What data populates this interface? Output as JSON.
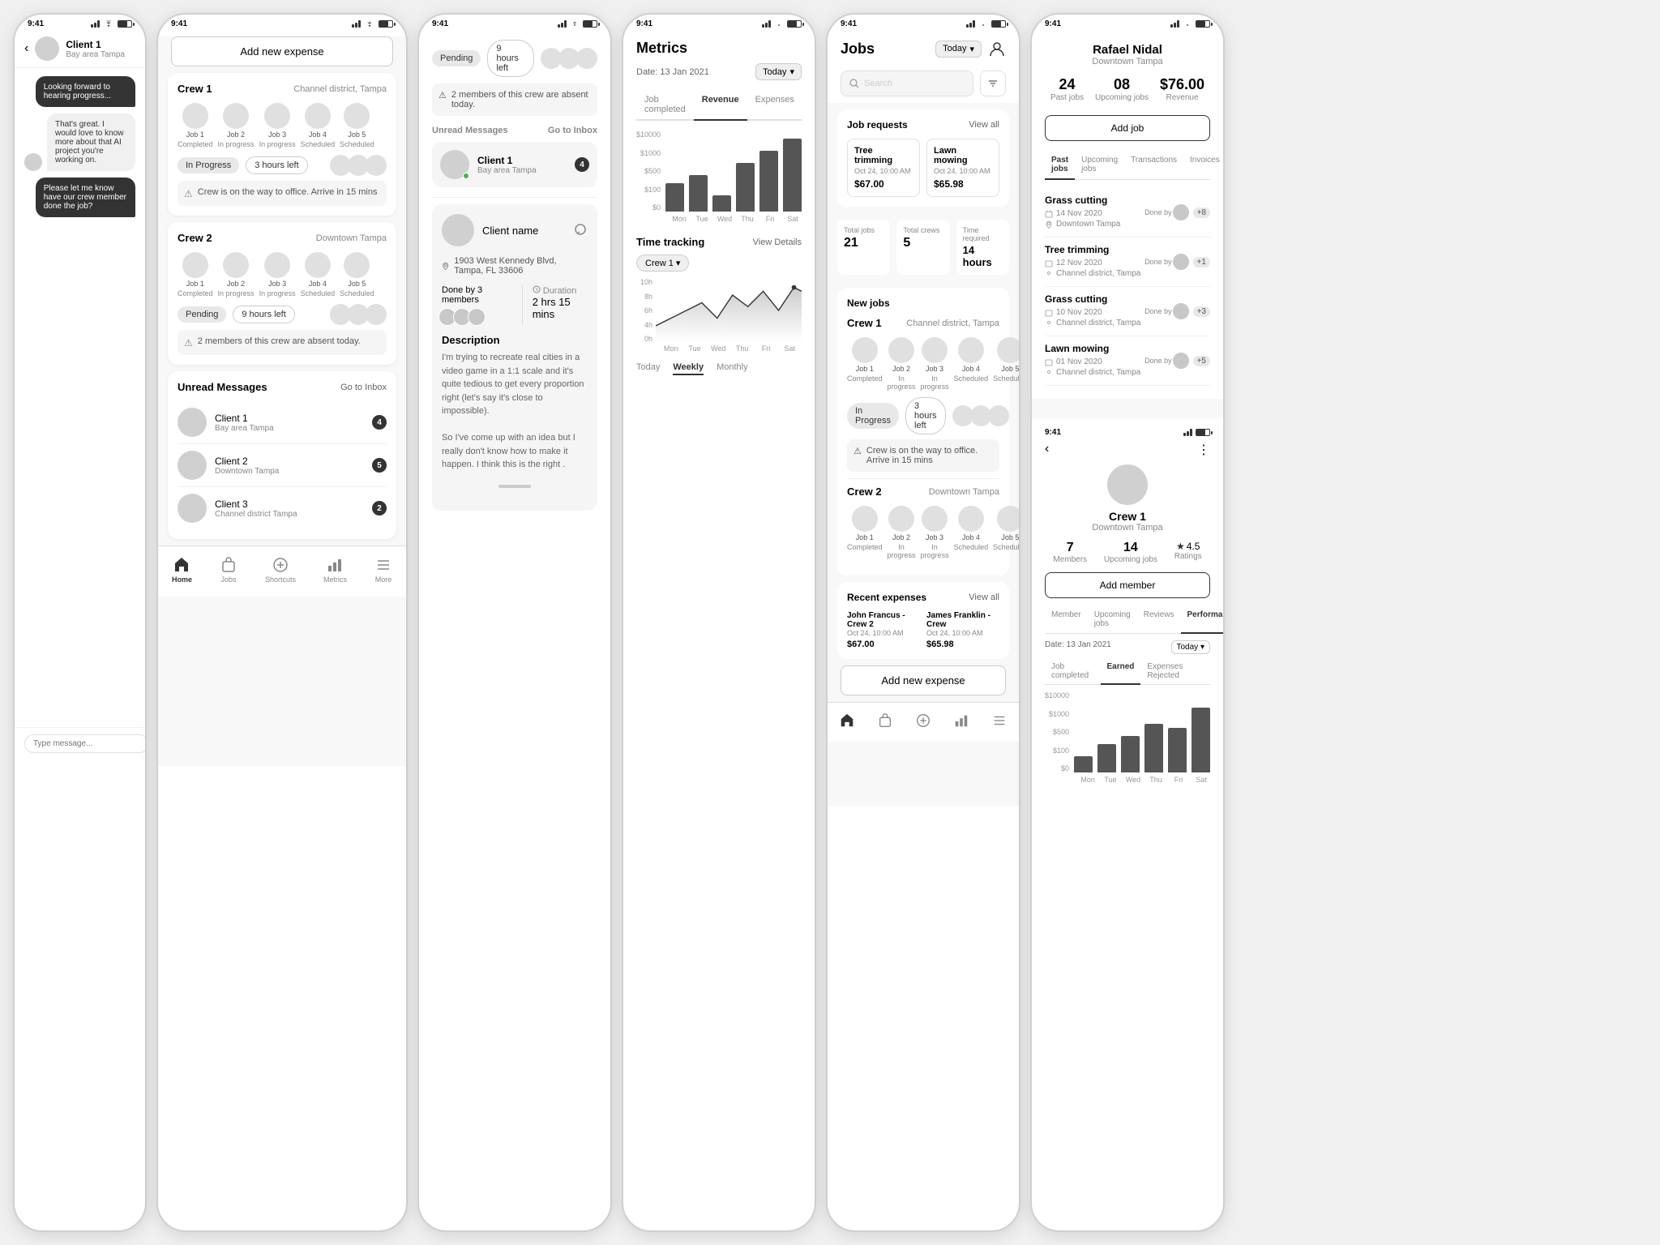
{
  "panels": {
    "panel1": {
      "title": "Home",
      "addExpenseBtn": "Add new expense",
      "crew1": {
        "name": "Crew 1",
        "location": "Channel district, Tampa",
        "status": "In Progress",
        "timeLeft": "3 hours left",
        "alert": "Crew is on the way to office. Arrive in 15 mins",
        "jobs": [
          {
            "label": "Job 1",
            "status": "Completed"
          },
          {
            "label": "Job 2",
            "status": "In progress"
          },
          {
            "label": "Job 3",
            "status": "In progress"
          },
          {
            "label": "Job 4",
            "status": "Scheduled"
          },
          {
            "label": "Job 5",
            "status": "Scheduled"
          }
        ]
      },
      "crew2": {
        "name": "Crew 2",
        "location": "Downtown Tampa",
        "status": "Pending",
        "timeLeft": "9 hours left",
        "alert": "2 members of this crew are absent today.",
        "jobs": [
          {
            "label": "Job 1",
            "status": "Completed"
          },
          {
            "label": "Job 2",
            "status": "In progress"
          },
          {
            "label": "Job 3",
            "status": "In progress"
          },
          {
            "label": "Job 4",
            "status": "Scheduled"
          },
          {
            "label": "Job 5",
            "status": "Scheduled"
          }
        ]
      },
      "messages": {
        "title": "Unread Messages",
        "link": "Go to Inbox",
        "clients": [
          {
            "name": "Client 1",
            "location": "Bay area Tampa",
            "count": 4
          },
          {
            "name": "Client 2",
            "location": "Downtown Tampa",
            "count": 5
          },
          {
            "name": "Client 3",
            "location": "Channel district Tampa",
            "count": 2
          }
        ]
      },
      "nav": {
        "items": [
          {
            "label": "Home",
            "icon": "home",
            "active": true
          },
          {
            "label": "Jobs",
            "icon": "jobs",
            "active": false
          },
          {
            "label": "Shortcuts",
            "icon": "shortcuts",
            "active": false
          },
          {
            "label": "Metrics",
            "icon": "metrics",
            "active": false
          },
          {
            "label": "More",
            "icon": "more",
            "active": false
          }
        ]
      }
    },
    "panel2": {
      "statusTime": "9:41",
      "pending": "Pending",
      "hoursLeft": "9 hours left",
      "alert": "2 members of this crew are absent today.",
      "clientName": "Client name",
      "location": "1903 West Kennedy Blvd, Tampa, FL 33606",
      "doneBy": "Done by 3 members",
      "duration": "Duration",
      "durationValue": "2 hrs 15 mins",
      "descriptionTitle": "Description",
      "descriptionText": "I'm trying to recreate real cities in a video game in a 1:1 scale and it's quite tedious to get every proportion right (let's say it's close to impossible).\n\nSo I've come up with an idea but I really don't know how to make it happen. I think this is the right ."
    },
    "panel3": {
      "statusTime": "9:41",
      "title": "Metrics",
      "dateLabel": "Date: 13 Jan 2021",
      "todayBtn": "Today",
      "tabs": [
        "Job completed",
        "Revenue",
        "Expenses"
      ],
      "activeTab": "Revenue",
      "chart": {
        "yLabels": [
          "$10000",
          "$1000",
          "$500",
          "$100",
          "$0"
        ],
        "xLabels": [
          "Mon",
          "Tue",
          "Wed",
          "Thu",
          "Fri",
          "Sat"
        ],
        "bars": [
          35,
          45,
          20,
          60,
          75,
          90
        ]
      },
      "timeTracking": {
        "title": "Time tracking",
        "link": "View Details",
        "crewLabel": "Crew 1",
        "yLabels": [
          "10h",
          "8h",
          "6h",
          "4h",
          "0h"
        ],
        "xLabels": [
          "Mon",
          "Tue",
          "Wed",
          "Thu",
          "Fri",
          "Sat"
        ]
      },
      "tabs2": [
        "Today",
        "Weekly",
        "Monthly"
      ],
      "activeTab2": "Weekly"
    },
    "panel4": {
      "statusTime": "9:41",
      "title": "Jobs",
      "todayBtn": "Today",
      "searchPlaceholder": "Search",
      "jobRequests": {
        "title": "Job requests",
        "link": "View all",
        "jobs": [
          {
            "title": "Tree trimming",
            "date": "Oct 24, 10:00 AM",
            "price": "$67.00"
          },
          {
            "title": "Lawn mowing",
            "date": "Oct 24, 10:00 AM",
            "price": "$65.98"
          }
        ]
      },
      "stats": [
        {
          "label": "Total jobs",
          "value": "21"
        },
        {
          "label": "Total crews",
          "value": "5"
        },
        {
          "label": "Time required",
          "value": "14 hours"
        }
      ],
      "newJobs": {
        "title": "New jobs",
        "crew1": {
          "name": "Crew 1",
          "location": "Channel district, Tampa",
          "jobs": [
            {
              "label": "Job 1",
              "status": "Completed"
            },
            {
              "label": "Job 2",
              "status": "In progress"
            },
            {
              "label": "Job 3",
              "status": "In progress"
            },
            {
              "label": "Job 4",
              "status": "Scheduled"
            },
            {
              "label": "Job 5",
              "status": "Scheduled"
            }
          ],
          "status": "In Progress",
          "timeLeft": "3 hours left",
          "alert": "Crew is on the way to office. Arrive in 15 mins"
        },
        "crew2": {
          "name": "Crew 2",
          "location": "Downtown Tampa",
          "jobs": [
            {
              "label": "Job 1",
              "status": "Completed"
            },
            {
              "label": "Job 2",
              "status": "In progress"
            },
            {
              "label": "Job 3",
              "status": "In progress"
            },
            {
              "label": "Job 4",
              "status": "Scheduled"
            },
            {
              "label": "Job 5",
              "status": "Scheduled"
            }
          ]
        }
      },
      "expenses": {
        "title": "Recent expenses",
        "link": "View all",
        "items": [
          {
            "name": "John Francus - Crew 2",
            "date": "Oct 24, 10:00 AM",
            "price": "$67.00"
          },
          {
            "name": "James Franklin - Crew",
            "date": "Oct 24, 10:00 AM",
            "price": "$65.98"
          }
        ]
      },
      "addExpenseBtn": "Add new expense"
    },
    "panel5": {
      "statusTime": "9:41",
      "client": {
        "name": "Rafael Nidal",
        "location": "Downtown Tampa",
        "pastJobs": "24",
        "pastJobsLabel": "Past jobs",
        "upcomingJobs": "08",
        "upcomingJobsLabel": "Upcoming jobs",
        "revenue": "$76.00",
        "revenueLabel": "Revenue",
        "addJobBtn": "Add job",
        "tabs": [
          "Past jobs",
          "Upcoming jobs",
          "Transactions",
          "Invoices"
        ],
        "activeTab": "Past jobs",
        "pastJobsList": [
          {
            "title": "Grass cutting",
            "date": "14 Nov 2020",
            "location": "Downtown Tampa",
            "doneBy": "+8"
          },
          {
            "title": "Tree trimming",
            "date": "12 Nov 2020",
            "location": "Channel district, Tampa",
            "doneBy": "+1"
          },
          {
            "title": "Grass cutting",
            "date": "10 Nov 2020",
            "location": "Channel district, Tampa",
            "doneBy": "+3"
          },
          {
            "title": "Lawn mowing",
            "date": "01 Nov 2020",
            "location": "Channel district, Tampa",
            "doneBy": "+5"
          }
        ]
      },
      "crew": {
        "name": "Crew 1",
        "location": "Downtown Tampa",
        "members": "7",
        "membersLabel": "Members",
        "upcomingJobs": "14",
        "upcomingJobsLabel": "Upcoming jobs",
        "rating": "4.5",
        "ratingLabel": "Ratings",
        "addMemberBtn": "Add member",
        "tabs": [
          "Member",
          "Upcoming jobs",
          "Reviews",
          "Performance"
        ],
        "activeTab": "Performance",
        "dateLabel": "Date: 13 Jan 2021",
        "todayBtn": "Today",
        "perfTabs": [
          "Job completed",
          "Earned",
          "Expenses Rejected"
        ],
        "activePerfTab": "Earned",
        "chart": {
          "yLabels": [
            "$10000",
            "$1000",
            "$500",
            "$100",
            "$0"
          ],
          "xLabels": [
            "Mon",
            "Tue",
            "Wed",
            "Thu",
            "Fri",
            "Sat"
          ],
          "bars": [
            20,
            35,
            45,
            60,
            55,
            80
          ]
        }
      }
    },
    "chatPanel": {
      "statusTime": "9:41",
      "clientName": "Client 1",
      "location": "Bay area Tampa",
      "messages": [
        {
          "type": "sent",
          "text": "Looking forward to hearing progress..."
        },
        {
          "type": "received",
          "text": "That's great. I would love to know more about that AI project you're working on."
        },
        {
          "type": "sent",
          "text": "Please let me know have our crew member done the job?"
        }
      ]
    }
  }
}
